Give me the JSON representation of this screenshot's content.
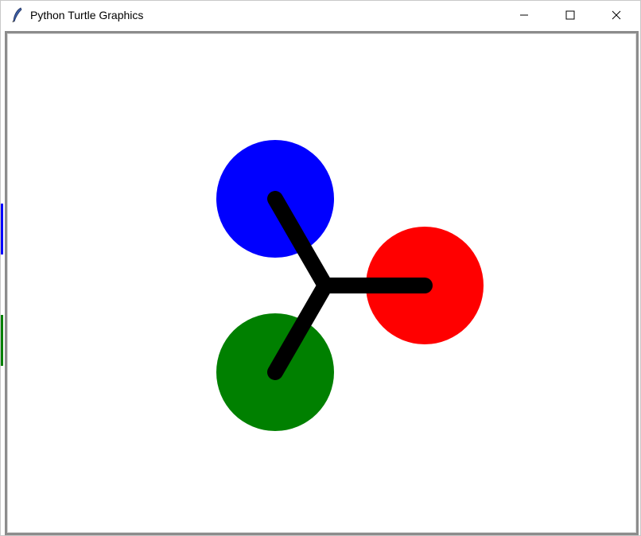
{
  "window": {
    "title": "Python Turtle Graphics",
    "controls": {
      "minimize": "minimize-icon",
      "maximize": "maximize-icon",
      "close": "close-icon"
    }
  },
  "canvas": {
    "background": "#ffffff",
    "dots": [
      {
        "name": "blue-dot",
        "color": "#0000ff"
      },
      {
        "name": "red-dot",
        "color": "#ff0000"
      },
      {
        "name": "green-dot",
        "color": "#008000"
      }
    ],
    "pen": {
      "color": "#000000"
    }
  },
  "colors": {
    "frame": "#8c8c8c",
    "titlebar": "#ffffff"
  }
}
